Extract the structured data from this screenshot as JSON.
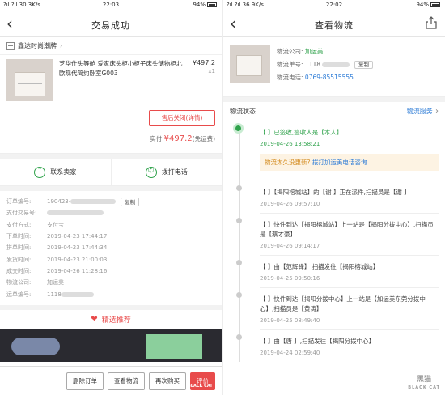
{
  "left": {
    "status": {
      "signal": "?ıl ?ıl 30.3K/s",
      "time": "22:03",
      "battery": "94%"
    },
    "title": "交易成功",
    "shop_name": "鑫达时尚潮牌",
    "goods": {
      "name": "芝华仕头等舱 爱家床头柜小柜子床头储物柜北欧现代简约卧室G003",
      "price": "¥497.2",
      "qty": "x1"
    },
    "after_sale_label": "售后关闭(详情)",
    "paid_label": "实付:",
    "paid_amount": "¥497.2",
    "paid_note": "(免运费)",
    "contact_seller": "联系卖家",
    "call_phone": "拨打电话",
    "info_rows": [
      {
        "k": "订单编号:",
        "v": "190423-",
        "copy": "复制"
      },
      {
        "k": "支付交易号:",
        "v": ""
      },
      {
        "k": "支付方式:",
        "v": "支付宝"
      },
      {
        "k": "下单时间:",
        "v": "2019-04-23 17:44:17"
      },
      {
        "k": "拼单时间:",
        "v": "2019-04-23 17:44:34"
      },
      {
        "k": "发货时间:",
        "v": "2019-04-23 21:00:03"
      },
      {
        "k": "成交时间:",
        "v": "2019-04-26 11:28:16"
      },
      {
        "k": "物流公司:",
        "v": "加运美"
      },
      {
        "k": "运单编号:",
        "v": "1118"
      }
    ],
    "recommend": "精选推荐",
    "buttons": [
      "删除订单",
      "查看物流",
      "再次购买",
      "评价"
    ],
    "watermark": "BLACK CAT"
  },
  "right": {
    "status": {
      "signal": "?ıl ?ıl 36.9K/s",
      "time": "22:02",
      "battery": "94%"
    },
    "title": "查看物流",
    "company_label": "物流公司:",
    "company": "加运美",
    "waybill_label": "物流单号:",
    "waybill": "1118",
    "copy": "复制",
    "phone_label": "物流电话:",
    "phone": "0769-85515555",
    "status_label": "物流状态",
    "service_label": "物流服务",
    "events": [
      {
        "text": "【 】已签收,签收人是【本人】",
        "date": "2019-04-26 13:58:21"
      },
      {
        "text": "【 】【揭阳榕城站】的【谢 】正在派件,扫描员是【谢 】",
        "date": "2019-04-26 09:57:10"
      },
      {
        "text": "【 】快件到达【揭阳榕城站】上一站是【揭阳分拨中心】,扫描员是【蔡才豪】",
        "date": "2019-04-26 09:14:17"
      },
      {
        "text": "【 】由【范辉锋】,扫描发往【揭阳榕城站】",
        "date": "2019-04-25 09:50:16"
      },
      {
        "text": "【 】快件到达【揭阳分拨中心】上一站是【加运美东莞分拨中心】,扫描员是【黄涛】",
        "date": "2019-04-25 08:49:40"
      },
      {
        "text": "【 】由【唐 】,扫描发往【揭阳分拨中心】",
        "date": "2019-04-24 02:59:40"
      }
    ],
    "tip_text": "物流太久没更新?",
    "tip_link": "拨打加运美电话咨询",
    "watermark_cn": "黑猫",
    "watermark_en": "BLACK CAT"
  }
}
